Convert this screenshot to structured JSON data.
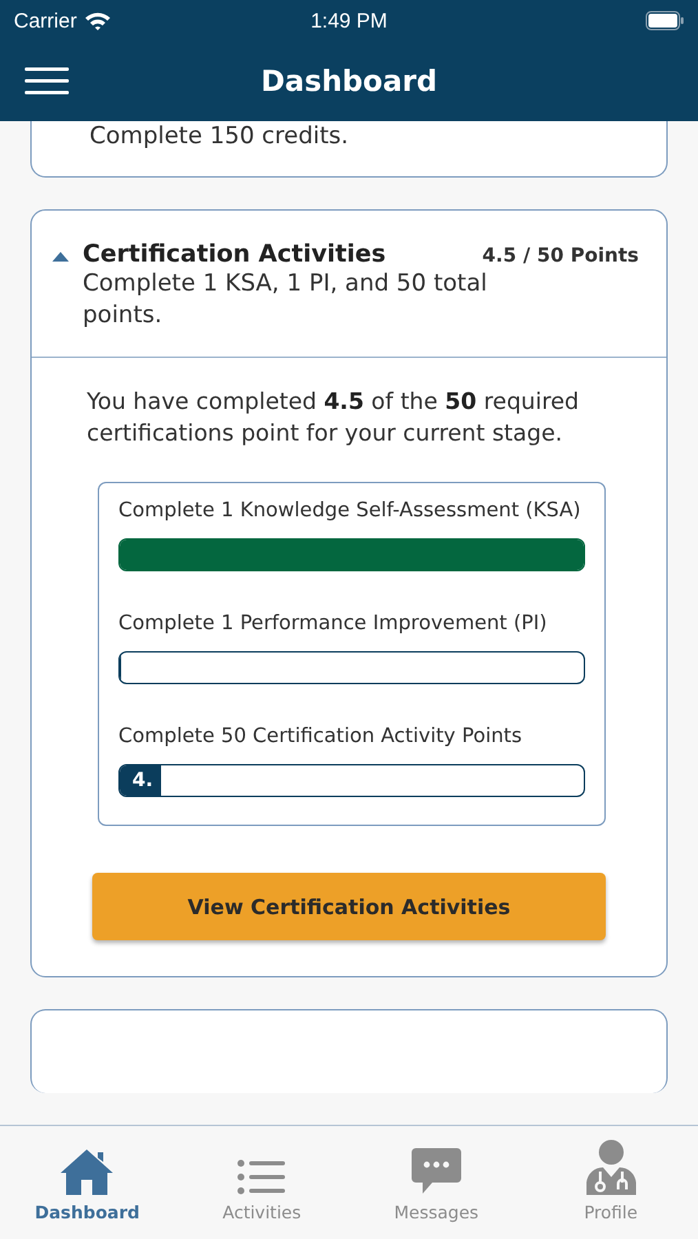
{
  "status_bar": {
    "carrier": "Carrier",
    "time": "1:49 PM"
  },
  "header": {
    "title": "Dashboard"
  },
  "cards": [
    {
      "kind": "clipped",
      "subtitle": "Complete 150 credits."
    },
    {
      "kind": "expanded",
      "expanded": true,
      "title": "Certification Activities",
      "subtitle": "Complete 1 KSA, 1 PI, and 50 total points.",
      "points": "4.5 / 50 Points",
      "summary": "You have completed **4.5** of the **50** required certifications point for your current stage.",
      "requirements": [
        {
          "label": "Complete 1 Knowledge Self-Assessment (KSA)",
          "level": 1,
          "color": "#04673f"
        },
        {
          "label": "Complete 1 Performance Improvement (PI)",
          "level": 0,
          "color": "#0b3d5c"
        },
        {
          "label": "Complete 50 Certification Activity Points",
          "level": 0.09,
          "color": "#0b3d5c",
          "fill_text": "4."
        }
      ],
      "button": "View Certification Activities"
    },
    {
      "kind": "peek"
    }
  ],
  "tabs": [
    {
      "label": "Dashboard",
      "kind": "home",
      "selected": true
    },
    {
      "label": "Activities",
      "kind": "list",
      "selected": false
    },
    {
      "label": "Messages",
      "kind": "chat",
      "selected": false
    },
    {
      "label": "Profile",
      "kind": "doctor",
      "selected": false
    }
  ]
}
